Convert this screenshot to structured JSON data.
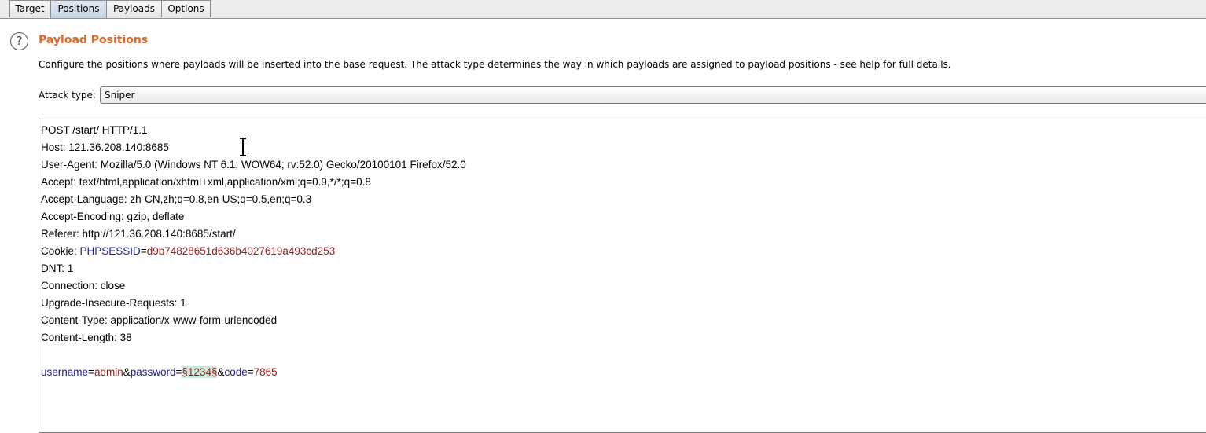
{
  "tabs": [
    {
      "label": "Target"
    },
    {
      "label": "Positions"
    },
    {
      "label": "Payloads"
    },
    {
      "label": "Options"
    }
  ],
  "active_tab": "Positions",
  "section": {
    "help_glyph": "?",
    "title": "Payload Positions",
    "description": "Configure the positions where payloads will be inserted into the base request. The attack type determines the way in which payloads are assigned to payload positions - see help for full details."
  },
  "attack_type": {
    "label": "Attack type:",
    "value": "Sniper"
  },
  "request": {
    "line1": "POST /start/ HTTP/1.1",
    "host": "Host: 121.36.208.140:8685",
    "user_agent": "User-Agent: Mozilla/5.0 (Windows NT 6.1; WOW64; rv:52.0) Gecko/20100101 Firefox/52.0",
    "accept": "Accept: text/html,application/xhtml+xml,application/xml;q=0.9,*/*;q=0.8",
    "accept_language": "Accept-Language: zh-CN,zh;q=0.8,en-US;q=0.5,en;q=0.3",
    "accept_encoding": "Accept-Encoding: gzip, deflate",
    "referer": "Referer: http://121.36.208.140:8685/start/",
    "cookie": {
      "prefix": "Cookie: ",
      "name": "PHPSESSID",
      "eq": "=",
      "value": "d9b74828651d636b4027619a493cd253"
    },
    "dnt": "DNT: 1",
    "connection": "Connection: close",
    "upgrade": "Upgrade-Insecure-Requests: 1",
    "content_type": "Content-Type: application/x-www-form-urlencoded",
    "content_length": "Content-Length: 38",
    "body": {
      "p1_name": "username",
      "eq1": "=",
      "p1_value": "admin",
      "amp1": "&",
      "p2_name": "password",
      "eq2": "=",
      "p2_value": "§1234§",
      "amp2": "&",
      "p3_name": "code",
      "eq3": "=",
      "p3_value": "7865"
    }
  },
  "colors": {
    "title_orange": "#e2662a",
    "param_name": "#1a1a9a",
    "param_value": "#9a1a1a",
    "payload_highlight": "#c8ebdd"
  }
}
